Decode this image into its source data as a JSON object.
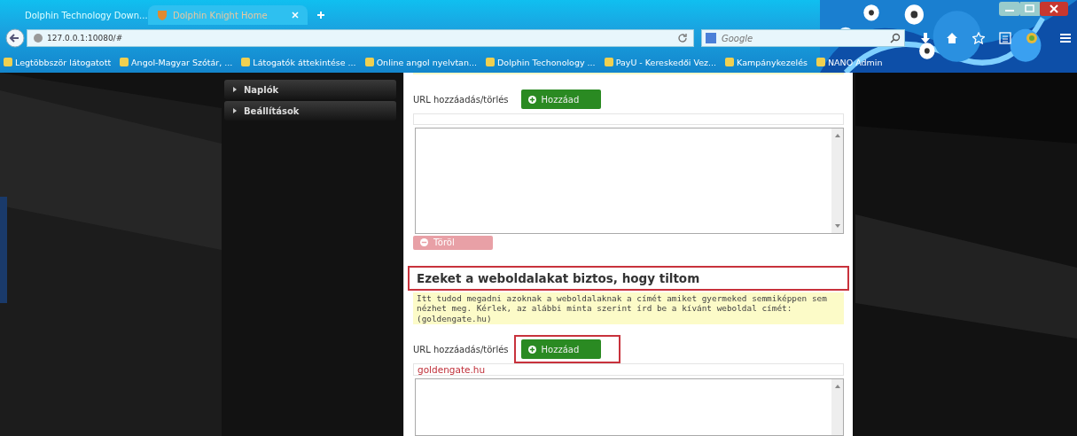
{
  "browser": {
    "tabs": [
      {
        "title": "Dolphin Technology Down...",
        "selected": false
      },
      {
        "title": "Dolphin Knight Home",
        "selected": true
      }
    ],
    "address": "127.0.0.1:10080/#",
    "search": {
      "placeholder": "Google"
    },
    "bookmarks": [
      "Legtöbbször látogatott",
      "Angol-Magyar Szótár, ...",
      "Látogatók áttekintése ...",
      "Online angol nyelvtan...",
      "Dolphin Techonology ...",
      "PayU - Kereskedői Vez...",
      "Kampánykezelés",
      "NANO Admin"
    ]
  },
  "sidebar": {
    "items": [
      {
        "label": "Naplók"
      },
      {
        "label": "Beállítások"
      }
    ]
  },
  "sections": [
    {
      "url_label": "URL hozzáadás/törlés",
      "add_button": {
        "label": "Hozzáad"
      },
      "delete_button": {
        "label": "Töröl",
        "disabled": true
      }
    },
    {
      "heading": "Ezeket a weboldalakat biztos, hogy tiltom",
      "heading_highlighted": true,
      "note": "Itt tudod megadni azoknak a weboldalaknak a címét amiket gyermeked semmiképpen sem nézhet meg. Kérlek, az alábbi minta szerint írd be a kívánt weboldal címét: (goldengate.hu)",
      "url_label": "URL hozzáadás/törlés",
      "add_button": {
        "label": "Hozzáad",
        "highlighted": true
      },
      "entries": [
        "goldengate.hu"
      ]
    }
  ]
}
